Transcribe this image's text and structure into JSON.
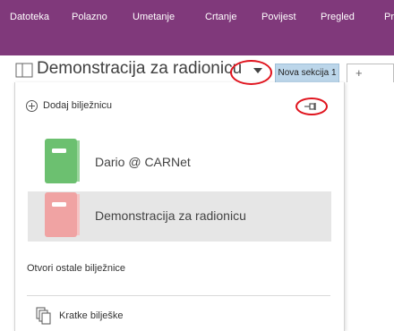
{
  "ribbon": {
    "background": "#80397b",
    "tabs": [
      "Datoteka",
      "Polazno",
      "Umetanje",
      "Crtanje",
      "Povijest",
      "Pregled",
      "Pr"
    ]
  },
  "notebook_bar": {
    "current_notebook": "Demonstracija za radionicu",
    "section_tab": "Nova sekcija 1",
    "add_section": "+"
  },
  "dropdown": {
    "add_notebook": "Dodaj bilježnicu",
    "pin_icon": "pin-icon",
    "notebooks": [
      {
        "name": "Dario @ CARNet",
        "color": "#6cc070",
        "selected": false
      },
      {
        "name": "Demonstracija za radionicu",
        "color": "#f0a3a3",
        "selected": true
      }
    ],
    "open_other": "Otvori ostale bilježnice",
    "quick_notes": "Kratke bilješke"
  },
  "annotations": {
    "ring_color": "#e0141e"
  }
}
